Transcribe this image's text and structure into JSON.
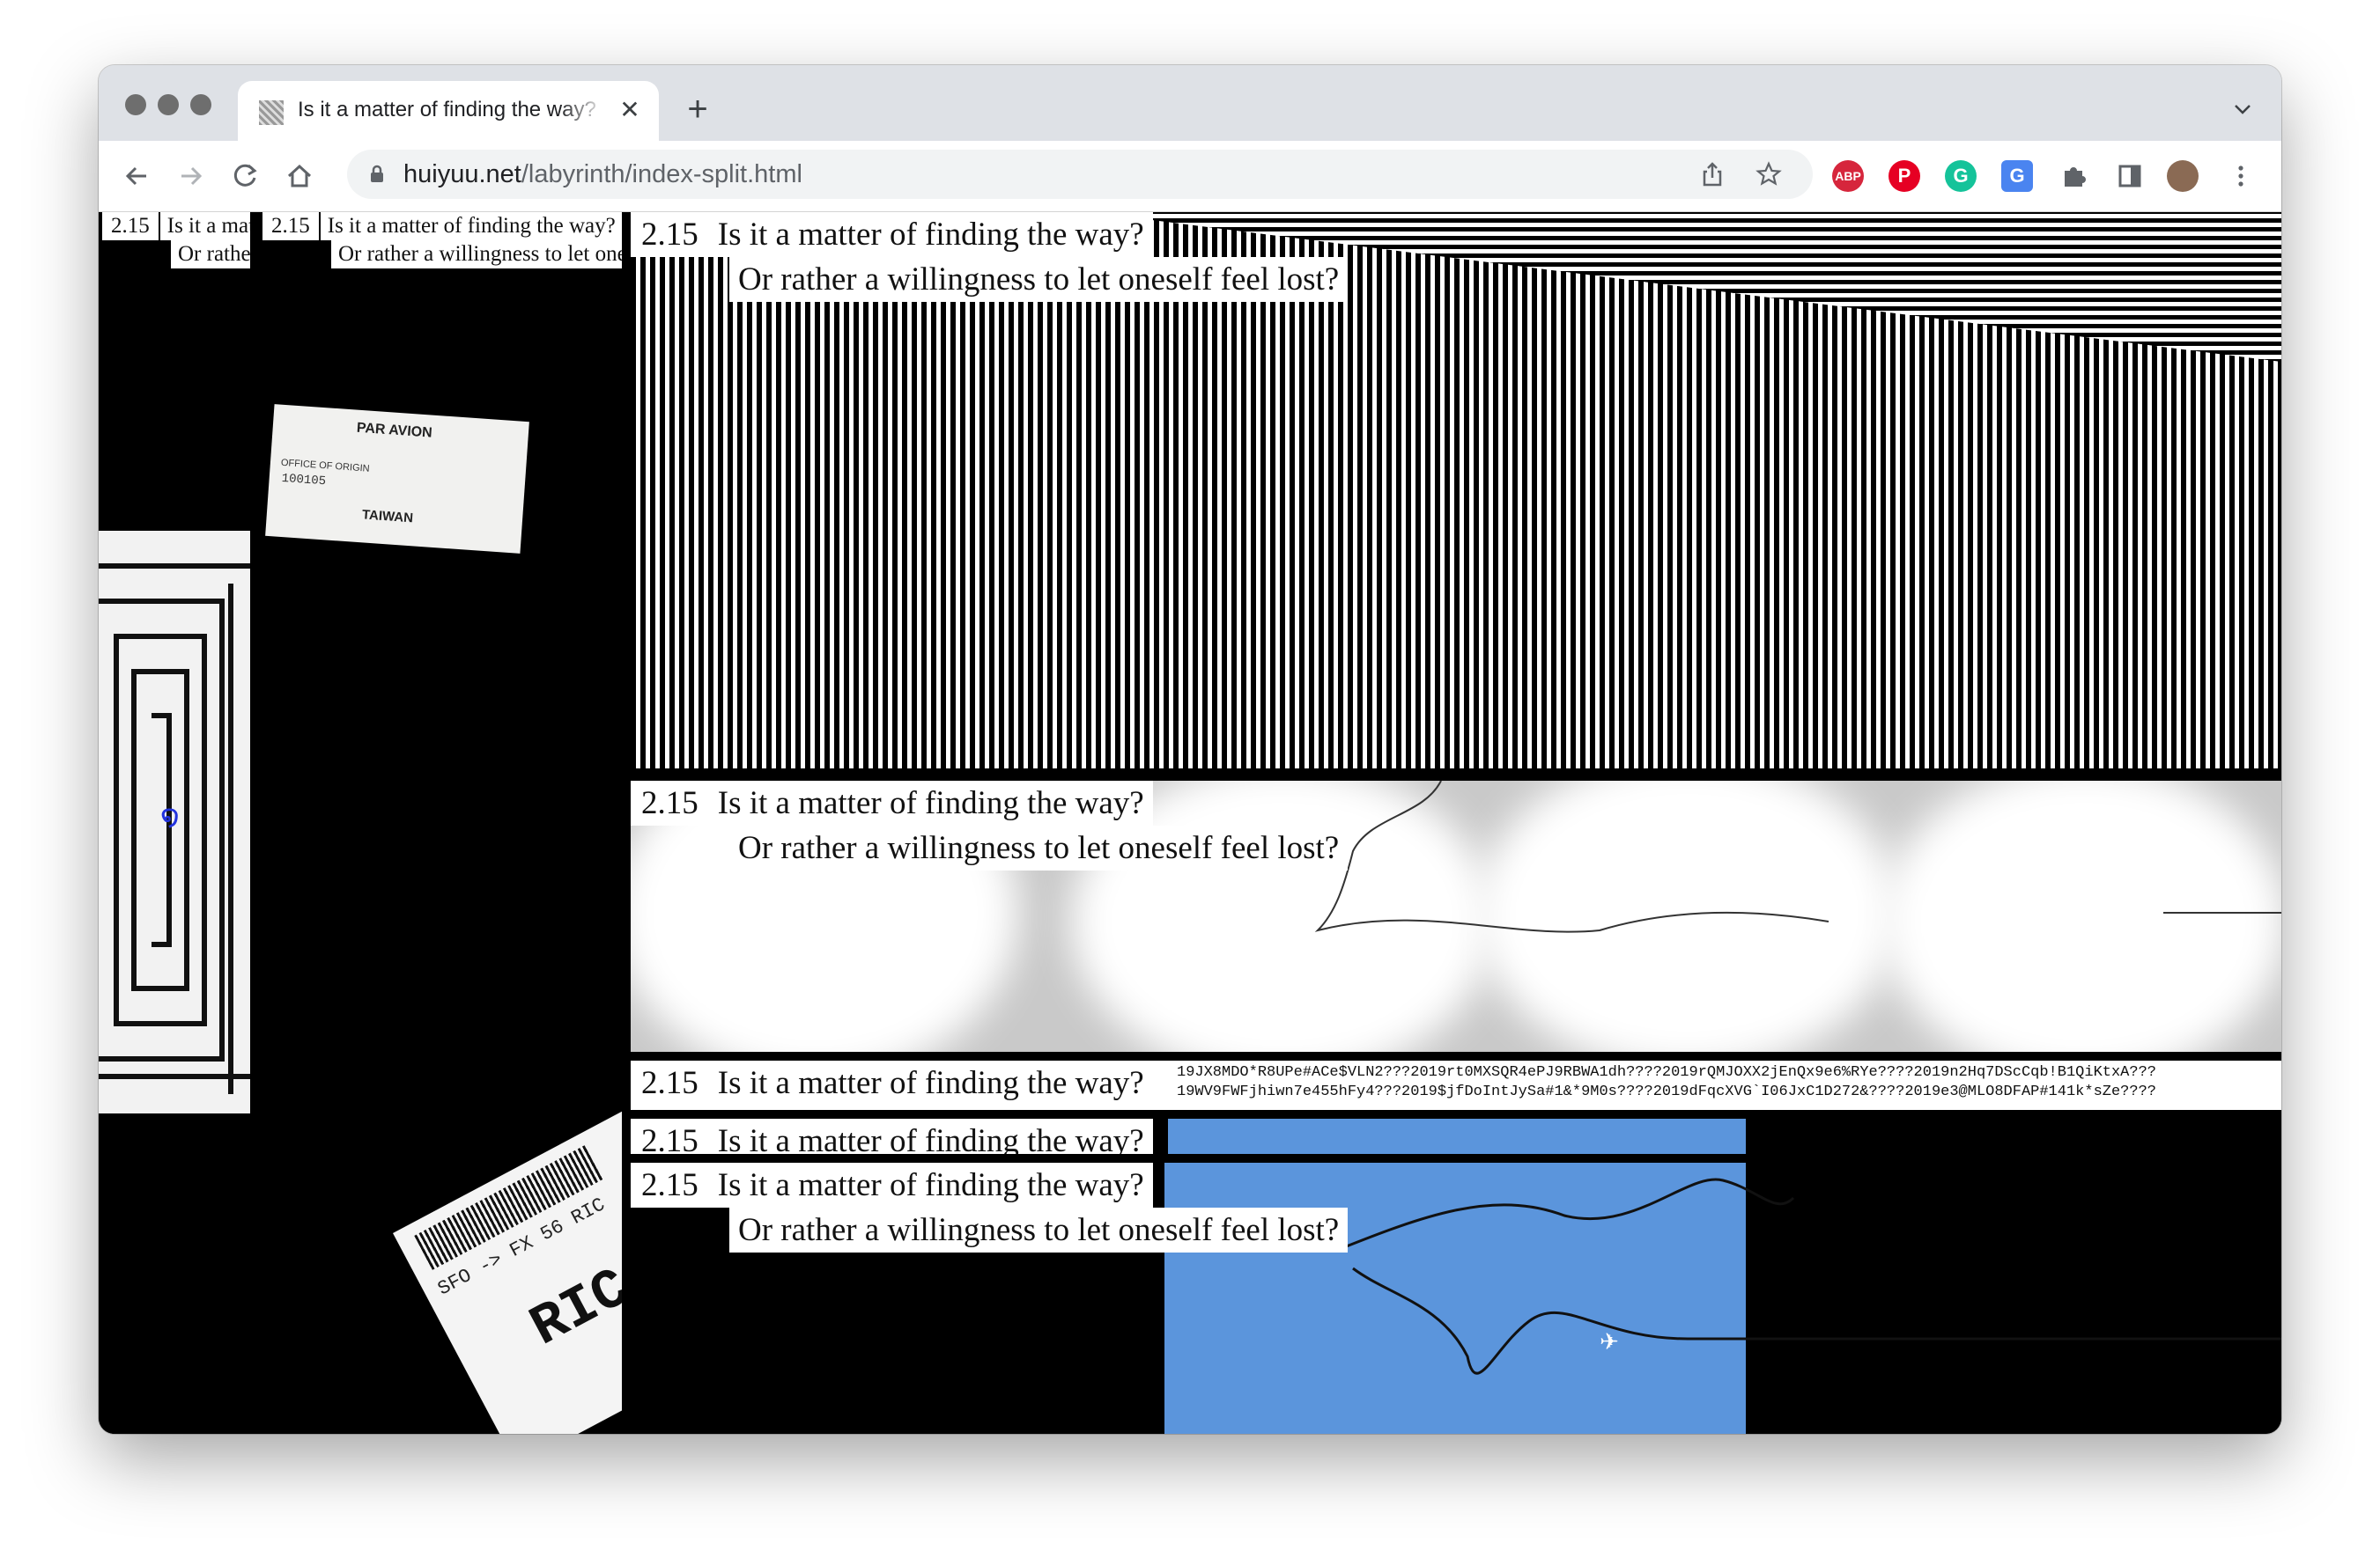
{
  "window": {
    "tab": {
      "title": "Is it a matter of finding the way?"
    },
    "toolbar": {
      "url_host": "huiyuu.net",
      "url_path": "/labyrinth/index-split.html"
    },
    "extensions": [
      {
        "name": "adblock-plus-icon",
        "label": "ABP",
        "color": "#d6263c"
      },
      {
        "name": "pinterest-icon",
        "label": "P",
        "color": "#e60023"
      },
      {
        "name": "grammarly-icon",
        "label": "G",
        "color": "#15c39a"
      },
      {
        "name": "google-translate-icon",
        "label": "G",
        "color": "#4a84f0"
      }
    ]
  },
  "page": {
    "caption_number": "2.15",
    "line1": "Is it a matter of finding the way?",
    "line2": "Or rather a willingness to let oneself feel lost?",
    "label_par_avion": "PAR AVION",
    "label_office": "OFFICE  OF  ORIGIN",
    "label_code": "100105",
    "label_country": "TAIWAN",
    "tag_route": "SFO -> FX   56  RIC",
    "tag_big": "RIC",
    "code_line1": "19JX8MDO*R8UPe#ACe$VLN2???2019rt0MXSQR4ePJ9RBWA1dh????2019rQMJOXX2jEnQx9e6%RYe????2019n2Hq7DScCqb!B1QiKtxA???",
    "code_line2": "19WV9FWFjhiwn7e455hFy4???2019$jfDoIntJySa#1&*9M0s????2019dFqcXVG`I06JxC1D272&????2019e3@MLO8DFAP#141k*sZe????"
  }
}
